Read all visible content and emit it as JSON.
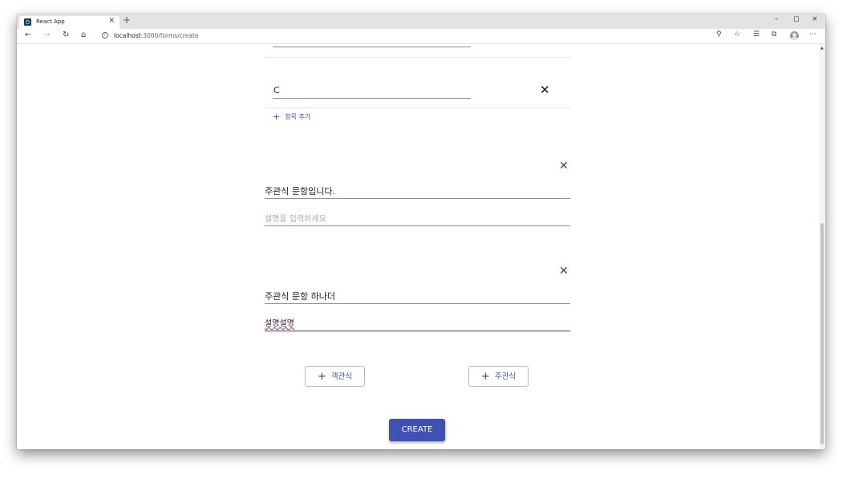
{
  "browser": {
    "tab_title": "React App",
    "tab_close": "×",
    "new_tab": "+",
    "window_controls": {
      "minimize": "–",
      "maximize": "◻",
      "close": "×"
    },
    "nav": {
      "back": "←",
      "forward": "→",
      "refresh": "↻",
      "home": "⌂"
    },
    "url_host": "localhost",
    "url_path": ":3000/forms/create",
    "tools": {
      "search": "⚲",
      "favorite": "☆",
      "favorites_bar": "☰",
      "collections": "⧉",
      "more": "···"
    }
  },
  "form": {
    "option_value": "C",
    "remove_option": "✕",
    "add_option_icon": "+",
    "add_option_label": "항목 추가",
    "questions": [
      {
        "remove": "✕",
        "title": "주관식 문항입니다.",
        "description": "",
        "description_placeholder": "설명을 입력하세요"
      },
      {
        "remove": "✕",
        "title": "주관식 문항 하나더",
        "description": "설명설명",
        "description_placeholder": ""
      }
    ],
    "add_multiple_choice_label": "객관식",
    "add_short_answer_label": "주관식",
    "plus_icon": "+",
    "create_label": "CREATE"
  },
  "colors": {
    "primary": "#3f51b5",
    "spellcheck": "#d32f2f"
  }
}
